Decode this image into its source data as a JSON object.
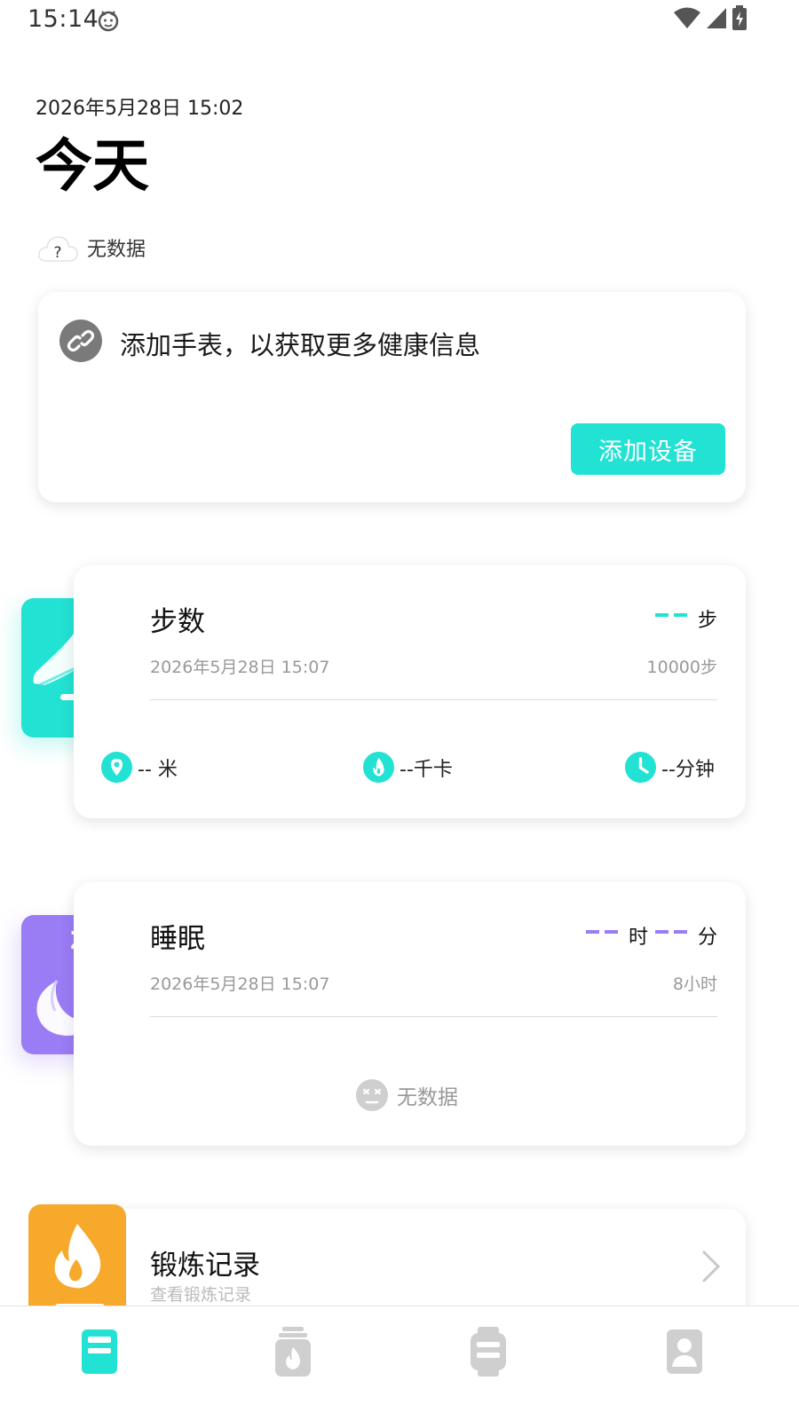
{
  "status_bar": {
    "time": "15:14"
  },
  "header": {
    "date": "2026年5月28日 15:02",
    "title": "今天",
    "weather_text": "无数据",
    "weather_icon": "cloud-question-icon"
  },
  "watch_card": {
    "message": "添加手表，以获取更多健康信息",
    "button_label": "添加设备",
    "icon": "link-icon"
  },
  "steps_card": {
    "title": "步数",
    "timestamp": "2026年5月28日 15:07",
    "value": "--",
    "unit": "步",
    "goal": "10000步",
    "distance": "-- 米",
    "calories": "--千卡",
    "duration": "--分钟",
    "accent_color": "#22e2d3"
  },
  "sleep_card": {
    "title": "睡眠",
    "timestamp": "2026年5月28日 15:07",
    "hours_value": "--",
    "hours_unit": "时",
    "minutes_value": "--",
    "minutes_unit": "分",
    "goal": "8小时",
    "empty_text": "无数据",
    "accent_color": "#9a7cf5"
  },
  "workout_card": {
    "title": "锻炼记录",
    "subtitle": "查看锻炼记录",
    "accent_color": "#f6a92a"
  },
  "bottom_nav": {
    "items": [
      {
        "name": "today-tab",
        "icon": "dashboard-icon",
        "active": true
      },
      {
        "name": "workout-tab",
        "icon": "flame-jar-icon",
        "active": false
      },
      {
        "name": "device-tab",
        "icon": "watch-icon",
        "active": false
      },
      {
        "name": "profile-tab",
        "icon": "person-icon",
        "active": false
      }
    ],
    "active_color": "#22e2d3",
    "inactive_color": "#c8c8c8"
  }
}
